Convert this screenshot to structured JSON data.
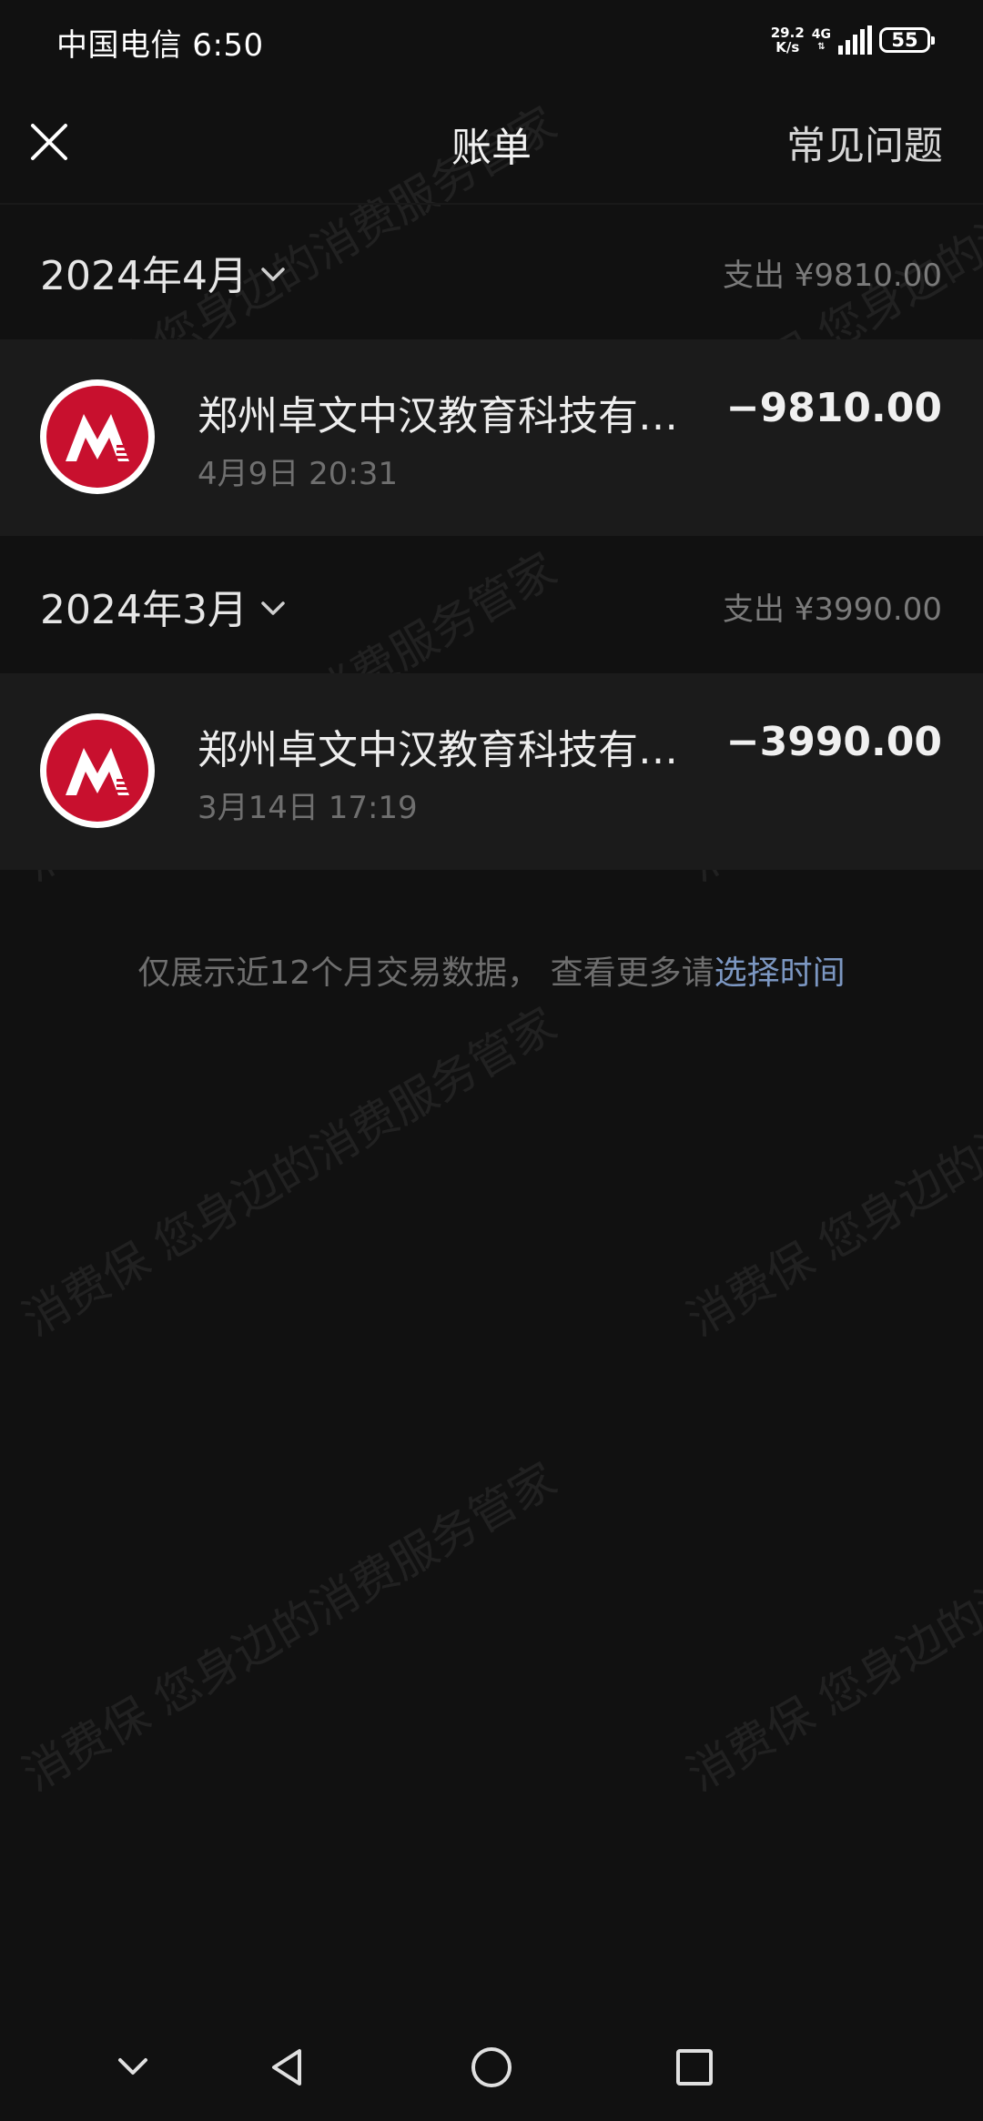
{
  "status_bar": {
    "carrier_time": "中国电信 6:50",
    "net_speed": "29.2",
    "net_unit": "K/s",
    "net_type": "4G",
    "battery": "55"
  },
  "header": {
    "title": "账单",
    "faq_label": "常见问题",
    "close_icon": "close-icon"
  },
  "months": [
    {
      "label": "2024年4月",
      "total": "支出 ¥9810.00",
      "transactions": [
        {
          "merchant": "郑州卓文中汉教育科技有…",
          "time": "4月9日 20:31",
          "amount": "−9810.00",
          "logo_icon": "bank-logo-icon"
        }
      ]
    },
    {
      "label": "2024年3月",
      "total": "支出 ¥3990.00",
      "transactions": [
        {
          "merchant": "郑州卓文中汉教育科技有…",
          "time": "3月14日 17:19",
          "amount": "−3990.00",
          "logo_icon": "bank-logo-icon"
        }
      ]
    }
  ],
  "footer": {
    "note": "仅展示近12个月交易数据，  查看更多请",
    "link": "选择时间"
  },
  "watermark": {
    "line_a": "消费保 您身边的消费服务管家"
  },
  "colors": {
    "background": "#111111",
    "row_background": "#1b1b1b",
    "link": "#7c97c2",
    "logo_red": "#c8102e"
  }
}
